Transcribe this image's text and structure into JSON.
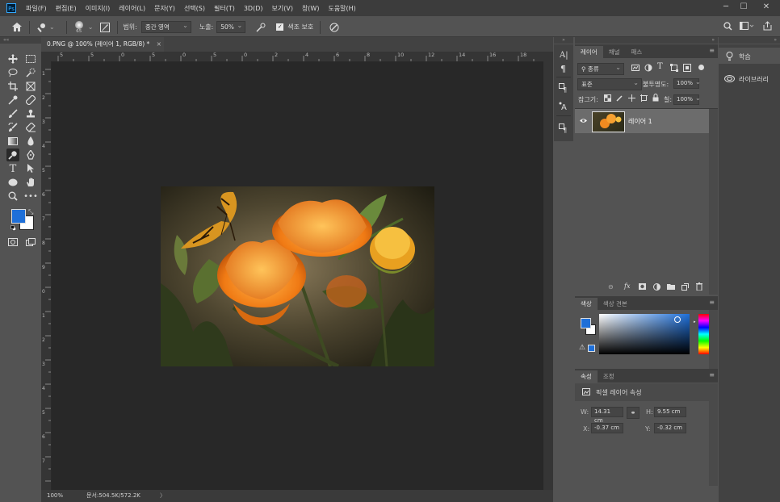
{
  "app": {
    "logo": "Ps"
  },
  "menu": [
    "파일(F)",
    "편집(E)",
    "이미지(I)",
    "레이어(L)",
    "문자(Y)",
    "선택(S)",
    "필터(T)",
    "3D(D)",
    "보기(V)",
    "창(W)",
    "도움말(H)"
  ],
  "window_controls": {
    "minimize": "─",
    "maximize": "☐",
    "close": "✕"
  },
  "options": {
    "brush_size": "65",
    "range_label": "범위:",
    "range_value": "중간 영역",
    "exposure_label": "노출:",
    "exposure_value": "50%",
    "protect_tones_label": "색조 보호",
    "protect_tones_checked": "✓"
  },
  "document": {
    "tab_title": "0.PNG @ 100% (레이어 1, RGB/8) *",
    "close": "×"
  },
  "ruler": {
    "h_ticks": [
      "5",
      "5",
      "0",
      "5",
      "0",
      "5",
      "0",
      "2",
      "4",
      "6",
      "8",
      "10",
      "12",
      "14",
      "16",
      "18"
    ],
    "v_ticks": [
      "1",
      "2",
      "3",
      "4",
      "5",
      "6",
      "7",
      "8",
      "9",
      "0",
      "1",
      "2",
      "3",
      "4",
      "5",
      "6",
      "7"
    ]
  },
  "status": {
    "zoom": "100%",
    "doc": "문서:504.5K/572.2K",
    "arrow": "〉"
  },
  "layers_panel": {
    "tabs": [
      "레이어",
      "채널",
      "패스"
    ],
    "filter_kind": "종류",
    "blend_mode": "표준",
    "opacity_label": "불투명도:",
    "opacity_value": "100%",
    "lock_label": "잠그기:",
    "fill_label": "칠:",
    "fill_value": "100%",
    "layer_name": "레이어 1"
  },
  "color_panel": {
    "tabs": [
      "색상",
      "색상 견본"
    ],
    "fg": "#1e6fd8",
    "bg": "#ffffff"
  },
  "properties_panel": {
    "tabs": [
      "속성",
      "조정"
    ],
    "title": "픽셀 레이어 속성",
    "w_label": "W:",
    "w_value": "14.31 cm",
    "h_label": "H:",
    "h_value": "9.55 cm",
    "x_label": "X:",
    "x_value": "-0.37 cm",
    "y_label": "Y:",
    "y_value": "-0.32 cm"
  },
  "right_panel": {
    "learn": "학습",
    "libraries": "라이브러리"
  },
  "colors": {
    "accent": "#31a8ff",
    "fg_swatch": "#1e6fd8"
  }
}
